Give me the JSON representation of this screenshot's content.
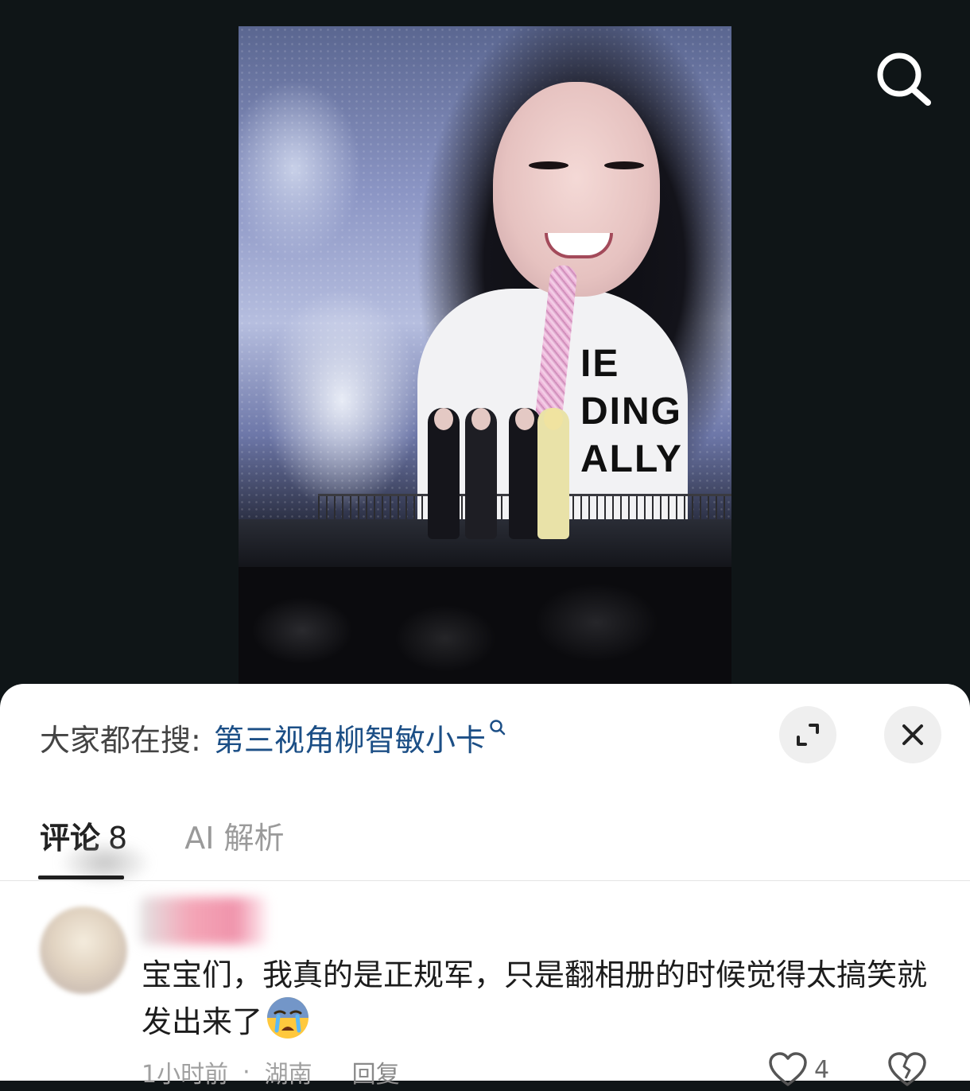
{
  "header": {
    "search_icon": "search-icon"
  },
  "photo": {
    "shirt_text": "IE\nDING\nALLY"
  },
  "sheet": {
    "trending_label": "大家都在搜:",
    "trending_query": "第三视角柳智敏小卡",
    "trending_icon": "search-small-icon",
    "expand_icon": "expand-icon",
    "close_icon": "close-icon"
  },
  "tabs": [
    {
      "label": "评论",
      "count": "8",
      "active": true
    },
    {
      "label": "AI 解析",
      "active": false
    }
  ],
  "comment": {
    "text": "宝宝们，我真的是正规军，只是翻相册的时候觉得太搞笑就发出来了",
    "emoji": "crying-face-emoji",
    "time": "1小时前",
    "separator": "·",
    "location": "湖南",
    "reply_label": "回复",
    "like_count": "4",
    "like_icon": "heart-icon",
    "dislike_icon": "broken-heart-icon"
  },
  "colors": {
    "background": "#0f1517",
    "sheet": "#ffffff",
    "link": "#1c4f86",
    "muted": "#a0a0a0"
  }
}
